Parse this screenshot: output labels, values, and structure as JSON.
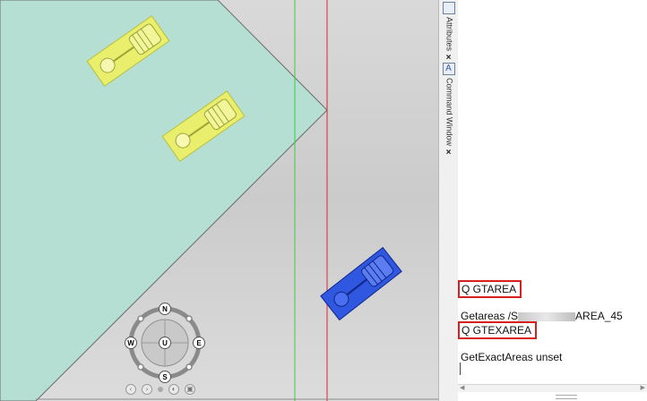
{
  "viewport": {
    "colors": {
      "floor": "#b2ddd0",
      "guide_green": "#3ccf3c",
      "guide_red": "#d8262a",
      "equip_yellow": "#e9ef6c",
      "equip_blue": "#2f57e0"
    }
  },
  "navcube": {
    "north": "N",
    "south": "S",
    "east": "E",
    "west": "W",
    "up": "U"
  },
  "sidebar": {
    "tabs": [
      {
        "label": "Attributes",
        "close": "×",
        "icon": "attributes-icon"
      },
      {
        "label": "Command Window",
        "close": "×",
        "icon": "command-window-icon"
      }
    ]
  },
  "command_window": {
    "lines": [
      {
        "text": "Q GTAREA",
        "highlighted": true
      },
      {
        "text_before": "Getareas  /S",
        "text_after": "AREA_45",
        "redacted": true
      },
      {
        "text": "Q GTEXAREA",
        "highlighted": true
      },
      {
        "text": "GetExactAreas  unset"
      }
    ]
  }
}
